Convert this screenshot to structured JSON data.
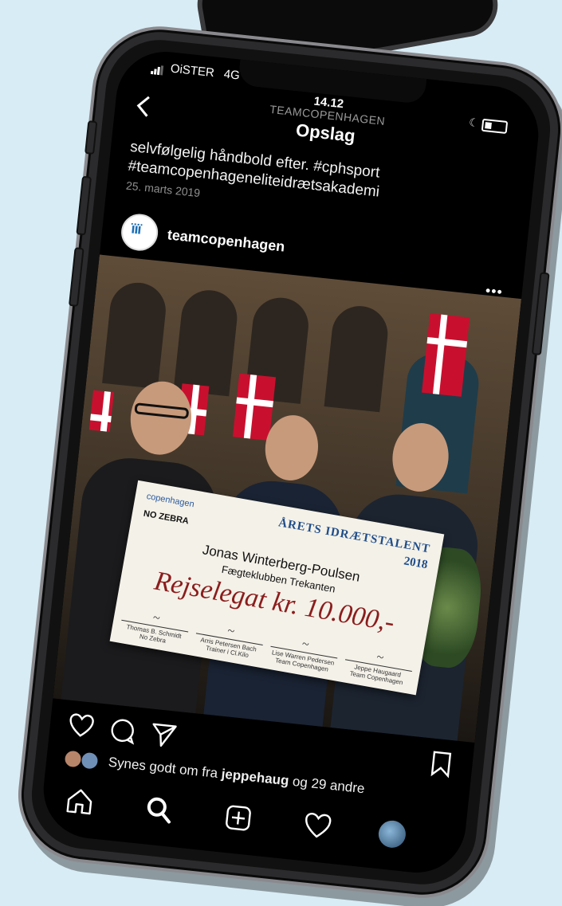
{
  "status_bar": {
    "carrier": "OiSTER",
    "network": "4G",
    "time": "14.12"
  },
  "nav": {
    "account": "TEAMCOPENHAGEN",
    "title": "Opslag"
  },
  "post": {
    "caption_line1": "selvfølgelig håndbold efter. #cphsport",
    "caption_line2": "#teamcopenhageneliteidrætsakademi",
    "date": "25. marts 2019",
    "username": "teamcopenhagen",
    "likes_prefix": "Synes godt om fra ",
    "likes_user": "jeppehaug",
    "likes_suffix": " og 29 andre"
  },
  "cheque": {
    "logo": "copenhagen",
    "sponsor": "NO ZEBRA",
    "title": "ÅRETS IDRÆTSTALENT",
    "year": "2018",
    "recipient": "Jonas Winterberg-Poulsen",
    "club": "Fægteklubben Trekanten",
    "amount": "Rejselegat kr. 10.000,-",
    "signatories": [
      {
        "name": "Thomas B. Schmidt",
        "org": "No Zebra"
      },
      {
        "name": "Arris Petersen Bach",
        "org": "Trainer i Cl.Kilo"
      },
      {
        "name": "Lise Warren Pedersen",
        "org": "Team Copenhagen"
      },
      {
        "name": "Jeppe Haugaard",
        "org": "Team Copenhagen"
      }
    ]
  },
  "icons": {
    "back": "chevron-left-icon",
    "more": "more-dots-icon",
    "like": "heart-icon",
    "comment": "comment-icon",
    "share": "send-icon",
    "save": "bookmark-icon",
    "home": "home-icon",
    "search": "search-icon",
    "add": "add-post-icon",
    "activity": "heart-icon",
    "profile": "profile-avatar"
  },
  "colors": {
    "background": "#d8ecf5",
    "screen": "#000000",
    "text": "#ffffff",
    "muted": "#8e8e8e",
    "flag_red": "#c8102e"
  }
}
